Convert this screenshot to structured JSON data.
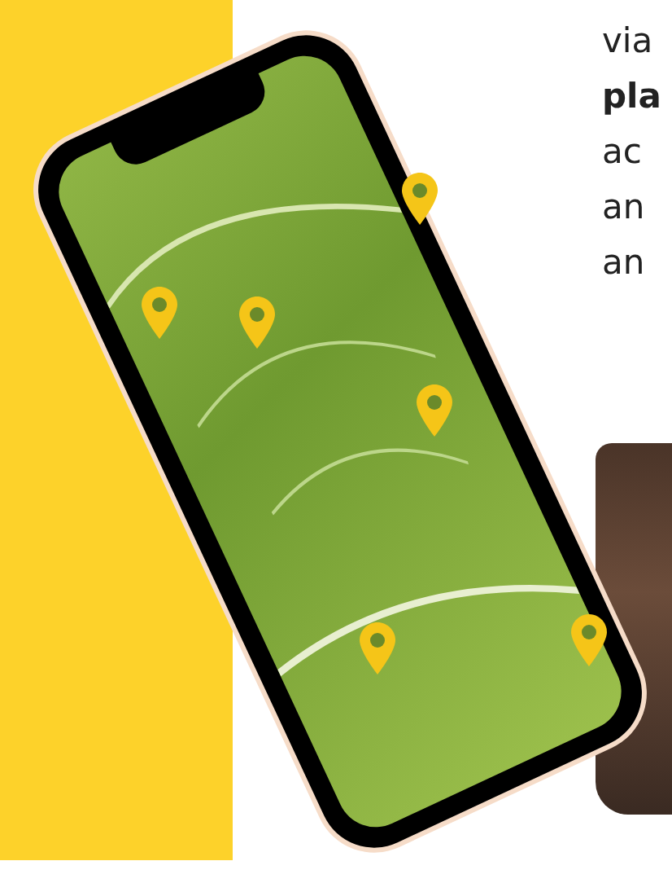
{
  "text_lines": [
    {
      "text": "via",
      "bold": false
    },
    {
      "text": "pla",
      "bold": true
    },
    {
      "text": "ac",
      "bold": false
    },
    {
      "text": "an",
      "bold": false
    },
    {
      "text": "an",
      "bold": false
    }
  ]
}
